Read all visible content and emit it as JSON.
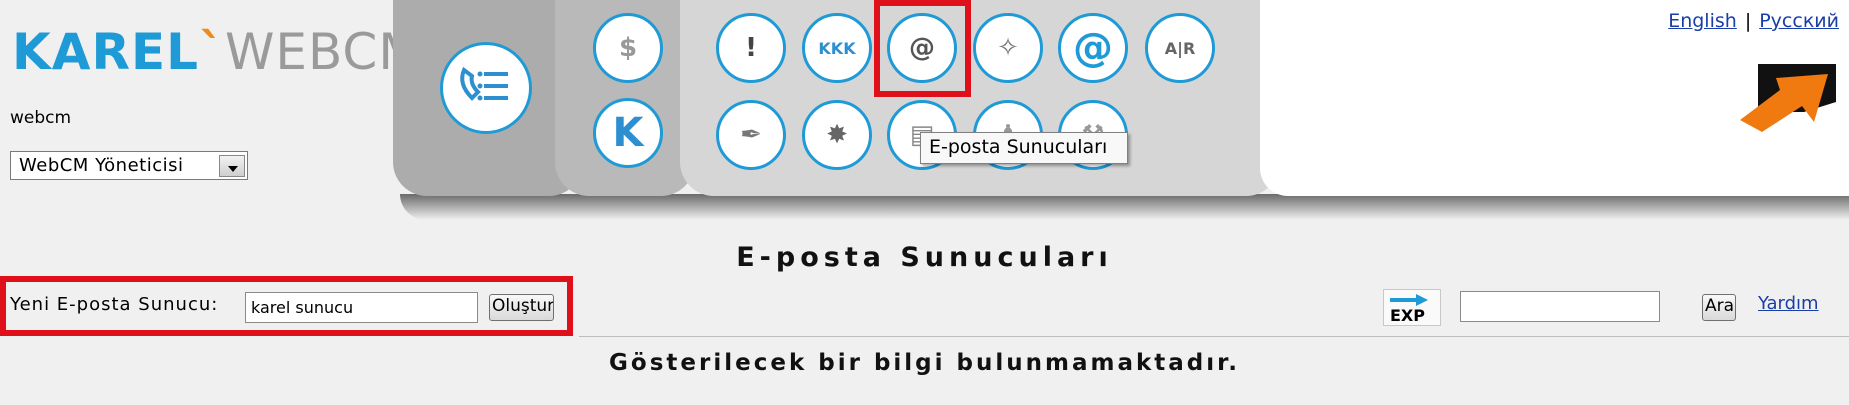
{
  "header": {
    "logo_brand": "KAREL",
    "logo_product": "WEBCM",
    "username": "webcm",
    "role_selected": "WebCM Yöneticisi"
  },
  "toolbar": {
    "tooltip": "E-posta Sunucuları",
    "row1_icons": [
      "alert-icon",
      "kkk-icon",
      "email-servers-icon",
      "fairy-icon",
      "at-sign-icon",
      "ar-book-icon"
    ],
    "row2_icons": [
      "quill-icon",
      "star-badge-icon",
      "chart-icon",
      "runner-icon",
      "wrench-icon"
    ],
    "left_icons": [
      "call-list-icon",
      "money-bag-icon",
      "k-logo-icon"
    ]
  },
  "lang": {
    "english": "English",
    "separator": "|",
    "russian": "Русский"
  },
  "page": {
    "title": "E-posta Sunucuları"
  },
  "form": {
    "label": "Yeni E-posta Sunucu:",
    "input_value": "karel sunucu",
    "create_button": "Oluştur"
  },
  "tools": {
    "export_label": "EXP",
    "search_value": "",
    "search_button": "Ara",
    "help_link": "Yardım"
  },
  "results": {
    "empty_message": "Gösterilecek bir bilgi bulunmamaktadır."
  },
  "colors": {
    "brand_blue": "#1e9ad6",
    "brand_orange": "#f08a1c",
    "highlight_red": "#e0101a",
    "link_blue": "#1a3ea8"
  }
}
